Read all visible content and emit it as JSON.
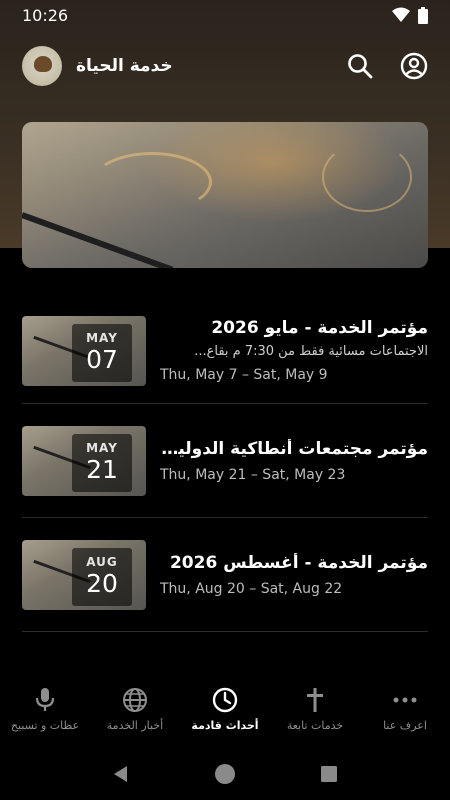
{
  "status_bar": {
    "time": "10:26"
  },
  "app_bar": {
    "title": "خدمة الحياة"
  },
  "icons": {
    "wifi": "wifi-icon",
    "battery": "battery-icon",
    "search": "search-icon",
    "account": "account-circle-icon",
    "back": "back-triangle-icon",
    "home": "home-circle-icon",
    "recents": "recents-square-icon"
  },
  "events": [
    {
      "month": "MAY",
      "day": "07",
      "title": "مؤتمر الخدمة - مايو 2026",
      "description": "الاجتماعات مسائية فقط من 7:30 م بقاع...",
      "dates": "Thu, May 7 – Sat, May 9"
    },
    {
      "month": "MAY",
      "day": "21",
      "title": "مؤتمر مجتمعات أنطاكية الدولية - ...",
      "description": "",
      "dates": "Thu, May 21 – Sat, May 23"
    },
    {
      "month": "AUG",
      "day": "20",
      "title": "مؤتمر الخدمة - أغسطس 2026",
      "description": "",
      "dates": "Thu, Aug 20 – Sat, Aug 22"
    }
  ],
  "bottom_nav": {
    "items": [
      {
        "label": "عظات و تسبيح",
        "icon": "microphone-icon"
      },
      {
        "label": "أخبار الخدمة",
        "icon": "globe-icon"
      },
      {
        "label": "أحداث قادمة",
        "icon": "clock-icon"
      },
      {
        "label": "خدمات تابعة",
        "icon": "cross-icon"
      },
      {
        "label": "اعرف عنا",
        "icon": "more-horizontal-icon"
      }
    ],
    "active_index": 2
  },
  "colors": {
    "background": "#000000",
    "header": "#2a231c",
    "text_primary": "#ffffff",
    "text_secondary": "#bdbdbd",
    "nav_inactive": "#8f8f8f"
  }
}
